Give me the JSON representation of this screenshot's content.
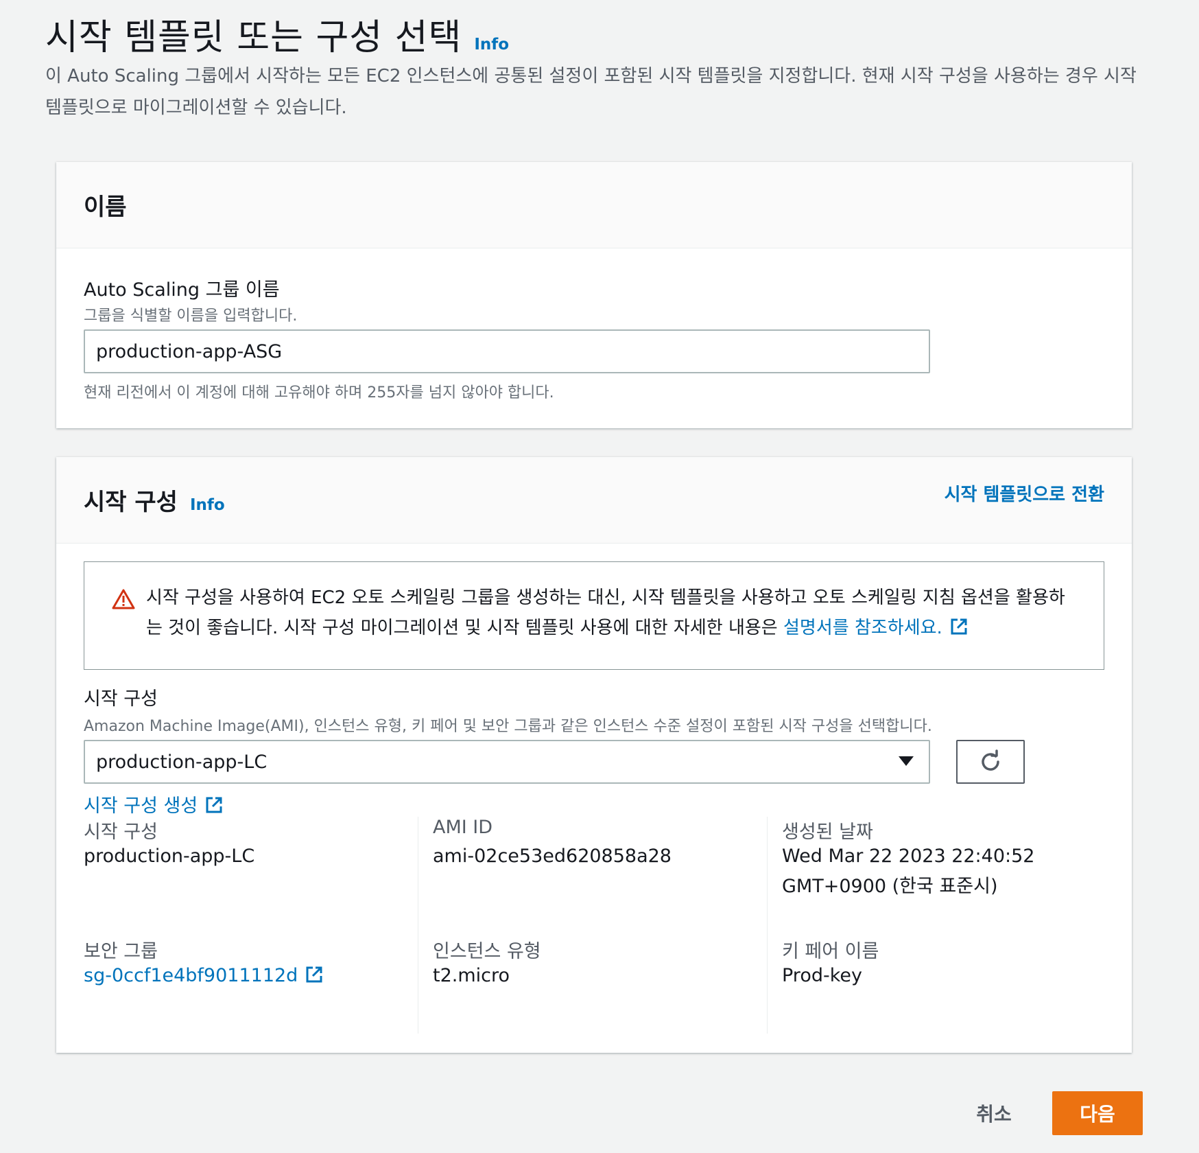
{
  "page": {
    "title": "시작 템플릿 또는 구성 선택",
    "info_label": "Info",
    "description": "이 Auto Scaling 그룹에서 시작하는 모든 EC2 인스턴스에 공통된 설정이 포함된 시작 템플릿을 지정합니다. 현재 시작 구성을 사용하는 경우 시작 템플릿으로 마이그레이션할 수 있습니다."
  },
  "name_section": {
    "title": "이름",
    "field_label": "Auto Scaling 그룹 이름",
    "field_description": "그룹을 식별할 이름을 입력합니다.",
    "field_value": "production-app-ASG",
    "constraint_text": "현재 리전에서 이 계정에 대해 고유해야 하며 255자를 넘지 않아야 합니다."
  },
  "launch_config_section": {
    "title": "시작 구성",
    "info_label": "Info",
    "switch_link": "시작 템플릿으로 전환",
    "alert": {
      "icon": "warning-icon",
      "text": "시작 구성을 사용하여 EC2 오토 스케일링 그룹을 생성하는 대신, 시작 템플릿을 사용하고 오토 스케일링 지침 옵션을 활용하는 것이 좋습니다. 시작 구성 마이그레이션 및 시작 템플릿 사용에 대한 자세한 내용은 ",
      "link_text": "설명서를 참조하세요."
    },
    "select_label": "시작 구성",
    "select_description": "Amazon Machine Image(AMI), 인스턴스 유형, 키 페어 및 보안 그룹과 같은 인스턴스 수준 설정이 포함된 시작 구성을 선택합니다.",
    "select_value": "production-app-LC",
    "create_link": "시작 구성 생성",
    "details": {
      "launch_config_key": "시작 구성",
      "launch_config_value": "production-app-LC",
      "ami_key": "AMI ID",
      "ami_value": "ami-02ce53ed620858a28",
      "created_key": "생성된 날짜",
      "created_value_line1": "Wed Mar 22 2023 22:40:52",
      "created_value_line2": "GMT+0900 (한국 표준시)",
      "security_group_key": "보안 그룹",
      "security_group_value": "sg-0ccf1e4bf9011112d",
      "instance_type_key": "인스턴스 유형",
      "instance_type_value": "t2.micro",
      "key_pair_key": "키 페어 이름",
      "key_pair_value": "Prod-key"
    }
  },
  "footer": {
    "cancel_label": "취소",
    "next_label": "다음"
  },
  "colors": {
    "link": "#0073bb",
    "primary_button": "#ec7211",
    "warning": "#d13212",
    "background": "#f2f3f3"
  }
}
